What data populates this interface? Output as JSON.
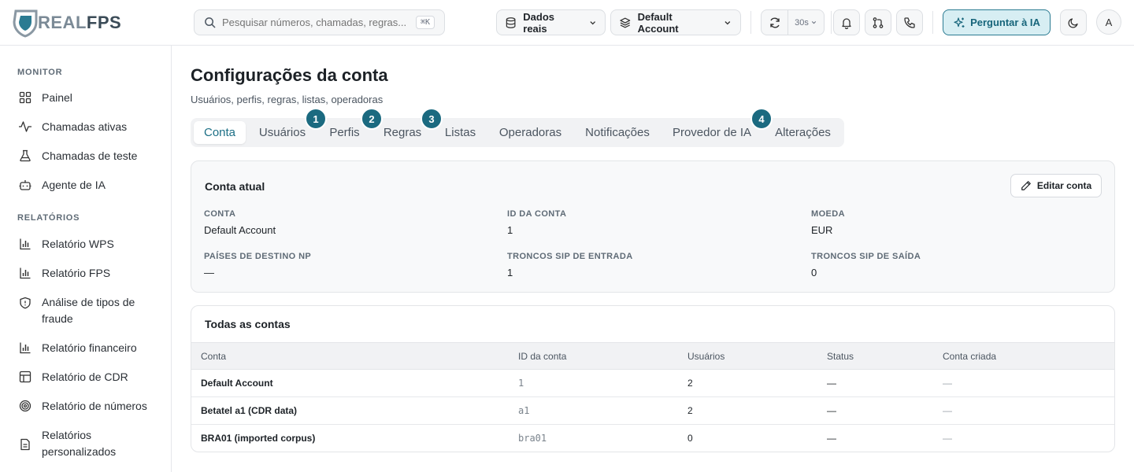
{
  "brand": {
    "part1": "REAL",
    "part2": "FPS"
  },
  "search": {
    "placeholder": "Pesquisar números, chamadas, regras...",
    "shortcut": "⌘K"
  },
  "header": {
    "data_source": "Dados reais",
    "account": "Default Account",
    "refresh_interval": "30s",
    "ask_ai": "Perguntar à IA",
    "avatar_initial": "A"
  },
  "sidebar": {
    "sections": [
      {
        "label": "MONITOR",
        "items": [
          {
            "label": "Painel",
            "icon": "dashboard-icon"
          },
          {
            "label": "Chamadas ativas",
            "icon": "activity-icon"
          },
          {
            "label": "Chamadas de teste",
            "icon": "flask-icon"
          },
          {
            "label": "Agente de IA",
            "icon": "bot-icon"
          }
        ]
      },
      {
        "label": "RELATÓRIOS",
        "items": [
          {
            "label": "Relatório WPS",
            "icon": "bar-chart-icon"
          },
          {
            "label": "Relatório FPS",
            "icon": "bar-chart-icon"
          },
          {
            "label": "Análise de tipos de fraude",
            "icon": "shield-icon"
          },
          {
            "label": "Relatório financeiro",
            "icon": "bar-chart-icon"
          },
          {
            "label": "Relatório de CDR",
            "icon": "table-icon"
          },
          {
            "label": "Relatório de números",
            "icon": "target-icon"
          },
          {
            "label": "Relatórios personalizados",
            "icon": "file-icon"
          }
        ]
      }
    ]
  },
  "page": {
    "title": "Configurações da conta",
    "subtitle": "Usuários, perfis, regras, listas, operadoras"
  },
  "tabs": [
    {
      "label": "Conta",
      "active": true
    },
    {
      "label": "Usuários"
    },
    {
      "label": "Perfis"
    },
    {
      "label": "Regras"
    },
    {
      "label": "Listas"
    },
    {
      "label": "Operadoras"
    },
    {
      "label": "Notificações"
    },
    {
      "label": "Provedor de IA"
    },
    {
      "label": "Alterações"
    }
  ],
  "badges": [
    "1",
    "2",
    "3",
    "4"
  ],
  "current_account": {
    "title": "Conta atual",
    "edit_label": "Editar conta",
    "fields": [
      {
        "label": "CONTA",
        "value": "Default Account"
      },
      {
        "label": "ID DA CONTA",
        "value": "1"
      },
      {
        "label": "MOEDA",
        "value": "EUR"
      },
      {
        "label": "PAÍSES DE DESTINO NP",
        "value": "—"
      },
      {
        "label": "TRONCOS SIP DE ENTRADA",
        "value": "1"
      },
      {
        "label": "TRONCOS SIP DE SAÍDA",
        "value": "0"
      }
    ]
  },
  "all_accounts": {
    "title": "Todas as contas",
    "columns": [
      "Conta",
      "ID da conta",
      "Usuários",
      "Status",
      "Conta criada"
    ],
    "rows": [
      {
        "name": "Default Account",
        "id": "1",
        "users": "2",
        "status": "—",
        "created": "—"
      },
      {
        "name": "Betatel a1 (CDR data)",
        "id": "a1",
        "users": "2",
        "status": "—",
        "created": "—"
      },
      {
        "name": "BRA01 (imported corpus)",
        "id": "bra01",
        "users": "0",
        "status": "—",
        "created": "—"
      }
    ]
  },
  "colors": {
    "accent": "#1b6a80",
    "accent_bg": "#d7eef3"
  }
}
